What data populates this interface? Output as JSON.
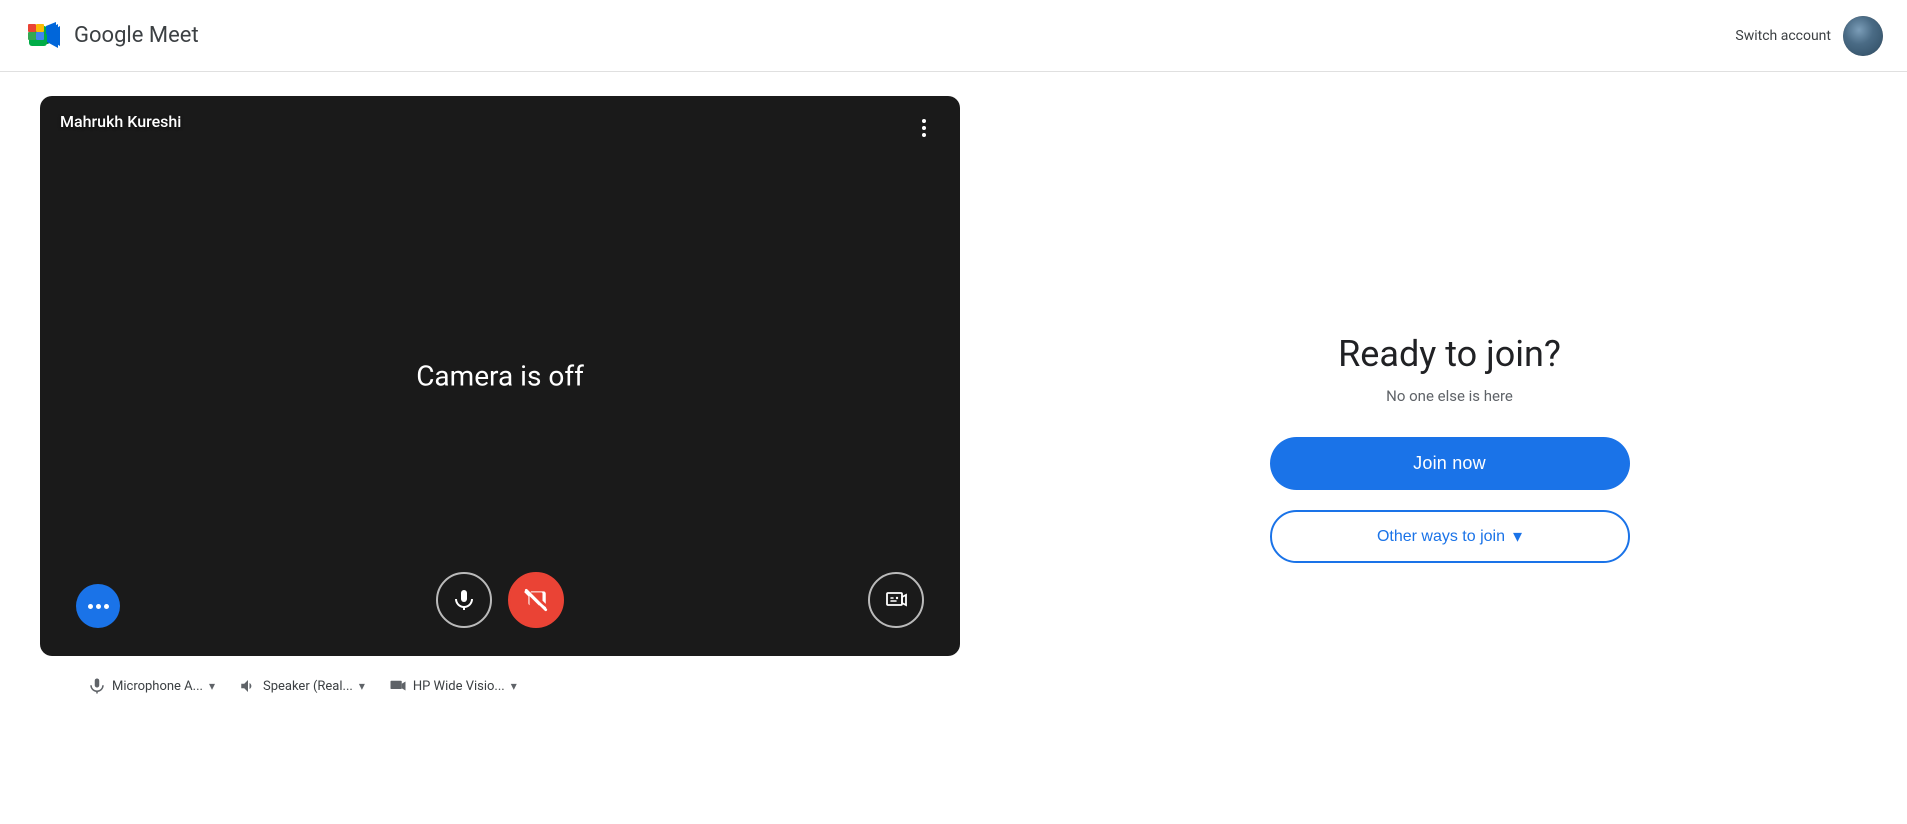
{
  "header": {
    "title": "Google Meet",
    "switch_account_label": "Switch account"
  },
  "video": {
    "participant_name": "Mahrukh Kureshi",
    "camera_off_text": "Camera is off",
    "more_options_label": "More options"
  },
  "controls": {
    "microphone_label": "Microphone",
    "camera_label": "Camera",
    "effects_label": "Visual effects",
    "more_label": "More options"
  },
  "toolbar": {
    "microphone_label": "Microphone A...",
    "speaker_label": "Speaker (Real...",
    "camera_label": "HP Wide Visio..."
  },
  "right_panel": {
    "ready_title": "Ready to join?",
    "no_one_text": "No one else is here",
    "join_now_label": "Join now",
    "other_ways_label": "Other ways to join"
  }
}
